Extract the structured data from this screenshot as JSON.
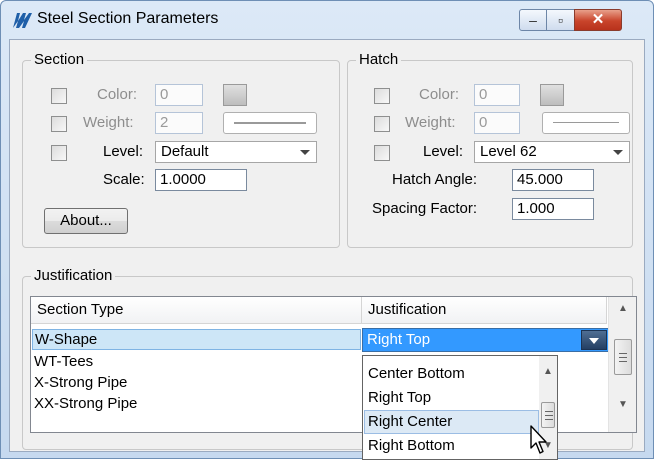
{
  "window": {
    "title": "Steel Section Parameters",
    "controls": {
      "minimize": "–",
      "maximize": "▫",
      "close": "✕"
    }
  },
  "section": {
    "label": "Section",
    "color_label": "Color:",
    "color_value": "0",
    "weight_label": "Weight:",
    "weight_value": "2",
    "level_label": "Level:",
    "level_value": "Default",
    "scale_label": "Scale:",
    "scale_value": "1.0000",
    "about_button": "About..."
  },
  "hatch": {
    "label": "Hatch",
    "color_label": "Color:",
    "color_value": "0",
    "weight_label": "Weight:",
    "weight_value": "0",
    "level_label": "Level:",
    "level_value": "Level 62",
    "angle_label": "Hatch Angle:",
    "angle_value": "45.000",
    "spacing_label": "Spacing Factor:",
    "spacing_value": "1.000"
  },
  "justification": {
    "label": "Justification",
    "columns": [
      "Section Type",
      "Justification"
    ],
    "rows": [
      "W-Shape",
      "WT-Tees",
      "X-Strong Pipe",
      "XX-Strong Pipe"
    ],
    "selected_row": "W-Shape",
    "selected_value": "Right Top",
    "dropdown_options": [
      "Center Bottom",
      "Right Top",
      "Right Center",
      "Right Bottom"
    ],
    "hovered_option": "Right Center"
  },
  "icons": [
    "app-logo-icon",
    "scroll-up-arrow-icon",
    "scroll-down-arrow-icon",
    "dropdown-arrow-icon",
    "mouse-cursor-icon"
  ]
}
